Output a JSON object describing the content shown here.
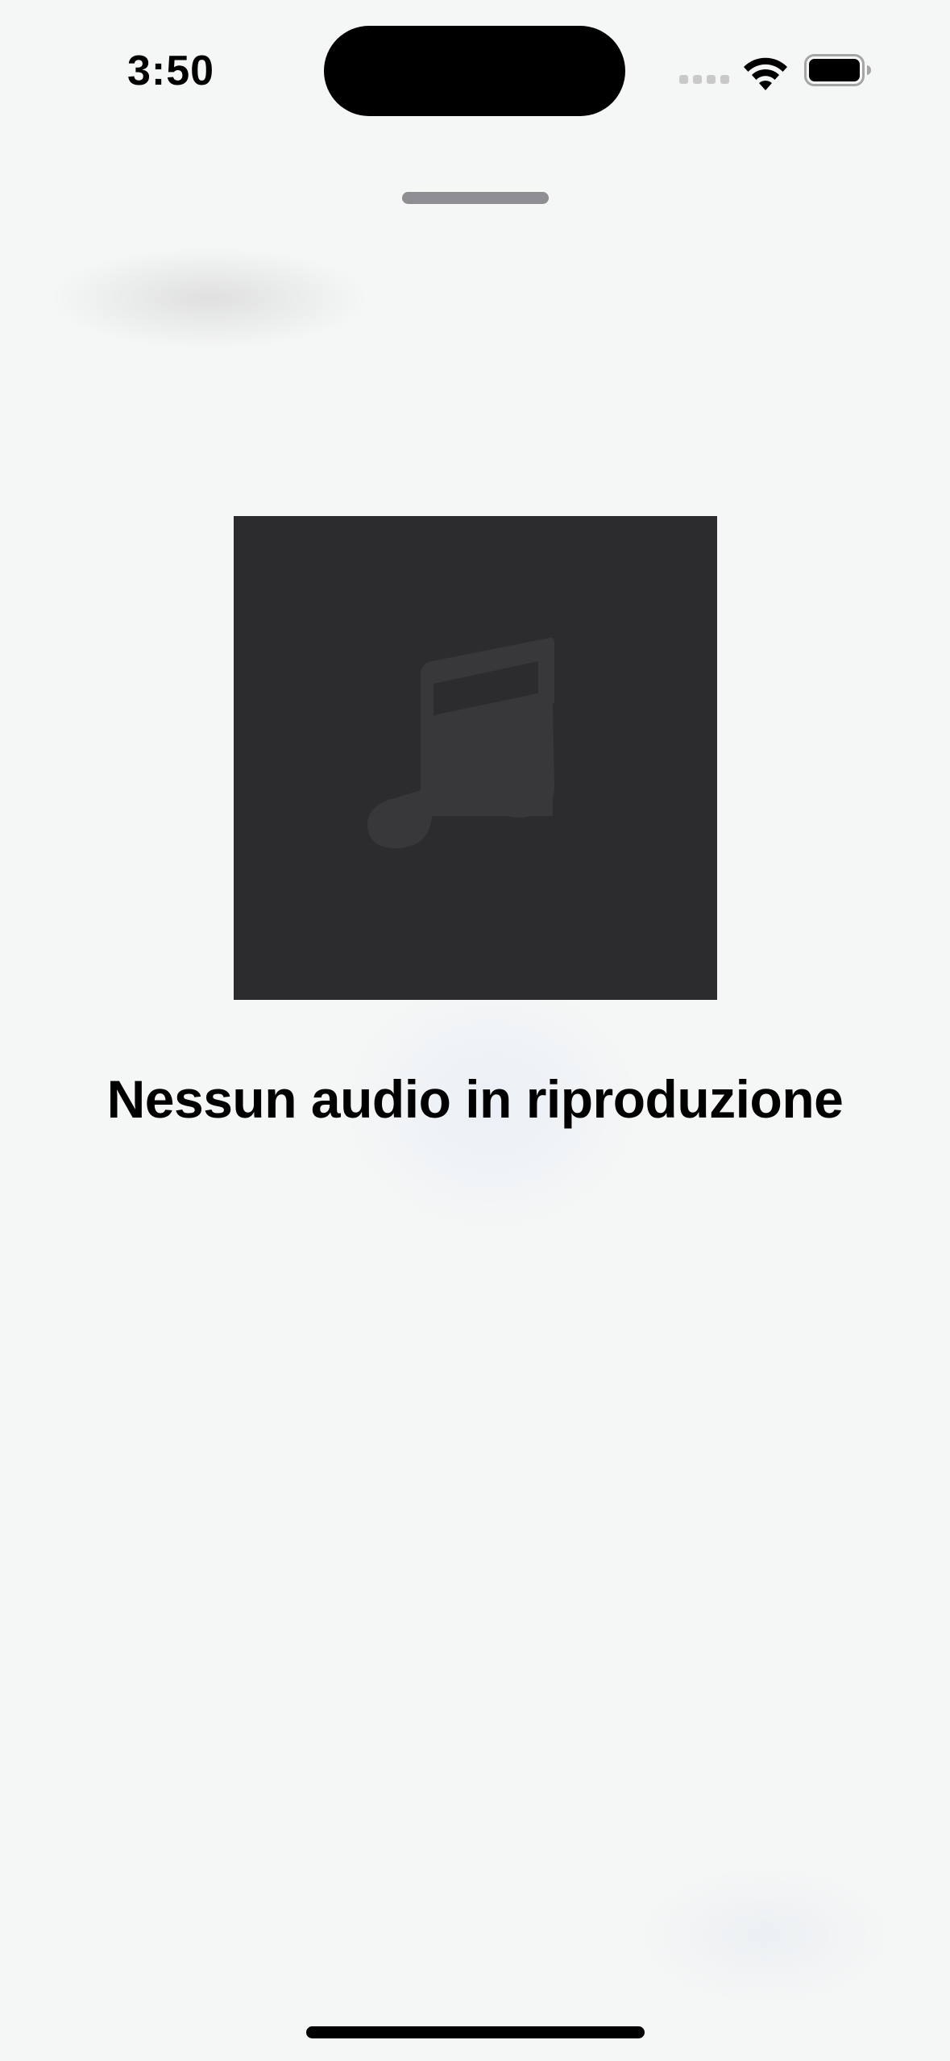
{
  "status_bar": {
    "time": "3:50",
    "icons": [
      "cellular-signal-icon",
      "wifi-icon",
      "battery-icon"
    ]
  },
  "player": {
    "artwork_icon": "music-note-icon",
    "title": "Nessun audio in riproduzione"
  },
  "colors": {
    "background": "#f5f6f6",
    "artwork_background": "#2c2c2e",
    "artwork_glyph": "#38383a",
    "grabber": "#8e8e93",
    "text": "#000000"
  }
}
